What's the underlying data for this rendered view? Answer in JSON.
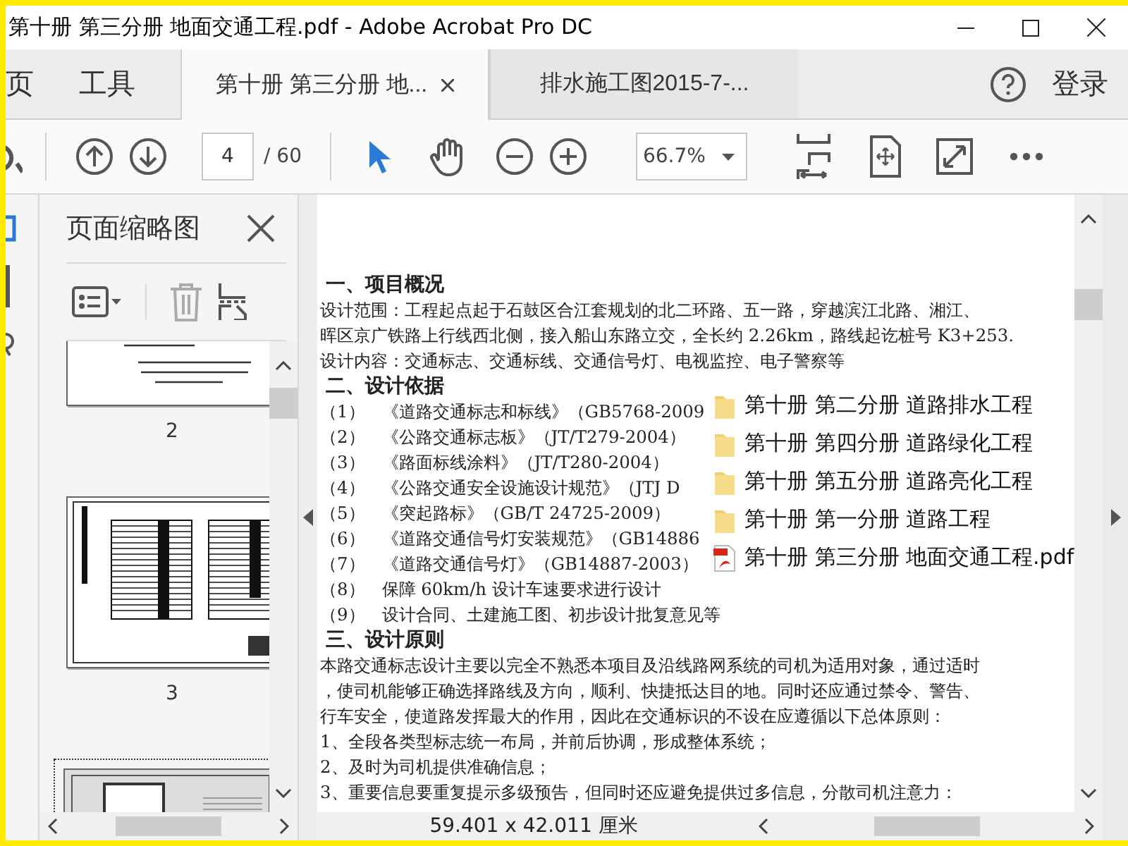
{
  "window": {
    "title": "第十册 第三分册 地面交通工程.pdf - Adobe Acrobat Pro DC"
  },
  "nav_tabs": [
    {
      "label": "页"
    },
    {
      "label": "工具"
    }
  ],
  "doc_tabs": [
    {
      "label": "第十册 第三分册 地...",
      "selected": true
    },
    {
      "label": "排水施工图2015-7-...",
      "selected": false
    }
  ],
  "account": {
    "label": "登录"
  },
  "toolbar": {
    "page": "4",
    "page_total": "/ 60",
    "zoom": "66.7%"
  },
  "sidebar": {
    "title": "页面缩略图",
    "thumbnails": [
      {
        "kind": "cover",
        "label": "2",
        "selected": false
      },
      {
        "kind": "table",
        "label": "3",
        "selected": false
      },
      {
        "kind": "plan",
        "selected": true
      }
    ]
  },
  "document": {
    "lines": [
      {
        "kind": "heading",
        "text": "一、项目概况"
      },
      {
        "kind": "line",
        "text": "设计范围：工程起点起于石鼓区合江套规划的北二环路、五一路，穿越滨江北路、湘江、"
      },
      {
        "kind": "line",
        "text": "晖区京广铁路上行线西北侧，接入船山东路立交，全长约 2.26km，路线起讫桩号 K3+253."
      },
      {
        "kind": "line",
        "text": "设计内容：交通标志、交通标线、交通信号灯、电视监控、电子警察等"
      },
      {
        "kind": "heading",
        "text": "二、设计依据"
      },
      {
        "kind": "line",
        "text": "（1）　《道路交通标志和标线》（GB5768-2009"
      },
      {
        "kind": "line",
        "text": "（2）　《公路交通标志板》（JT/T279-2004）"
      },
      {
        "kind": "line",
        "text": "（3）　《路面标线涂料》（JT/T280-2004）"
      },
      {
        "kind": "line",
        "text": "（4）　《公路交通安全设施设计规范》（JTJ D"
      },
      {
        "kind": "line",
        "text": "（5）　《突起路标》（GB/T 24725-2009）"
      },
      {
        "kind": "line",
        "text": "（6）　《道路交通信号灯安装规范》（GB14886"
      },
      {
        "kind": "line",
        "text": "（7）　《道路交通信号灯》（GB14887-2003）"
      },
      {
        "kind": "line",
        "text": "（8）　保障 60km/h 设计车速要求进行设计"
      },
      {
        "kind": "line",
        "text": "（9）　设计合同、土建施工图、初步设计批复意见等"
      },
      {
        "kind": "heading",
        "text": "三、设计原则"
      },
      {
        "kind": "line",
        "text": "本路交通标志设计主要以完全不熟悉本项目及沿线路网系统的司机为适用对象，通过适时"
      },
      {
        "kind": "line",
        "text": "，使司机能够正确选择路线及方向，顺利、快捷抵达目的地。同时还应通过禁令、警告、"
      },
      {
        "kind": "line",
        "text": "行车安全，使道路发挥最大的作用，因此在交通标识的不设在应遵循以下总体原则："
      },
      {
        "kind": "line",
        "text": "1、全段各类型标志统一布局，并前后协调，形成整体系统；"
      },
      {
        "kind": "line",
        "text": "2、及时为司机提供准确信息；"
      },
      {
        "kind": "line",
        "text": "3、重要信息要重复提示多级预告，但同时还应避免提供过多信息，分散司机注意力："
      }
    ]
  },
  "drag_list": [
    {
      "kind": "folder",
      "label": "第十册 第二分册 道路排水工程"
    },
    {
      "kind": "folder",
      "label": "第十册 第四分册 道路绿化工程"
    },
    {
      "kind": "folder",
      "label": "第十册 第五分册 道路亮化工程"
    },
    {
      "kind": "folder",
      "label": "第十册 第一分册 道路工程"
    },
    {
      "kind": "pdf",
      "label": "第十册 第三分册 地面交通工程.pdf"
    }
  ],
  "status_bar": {
    "page_size": "59.401 x 42.011 厘米"
  }
}
